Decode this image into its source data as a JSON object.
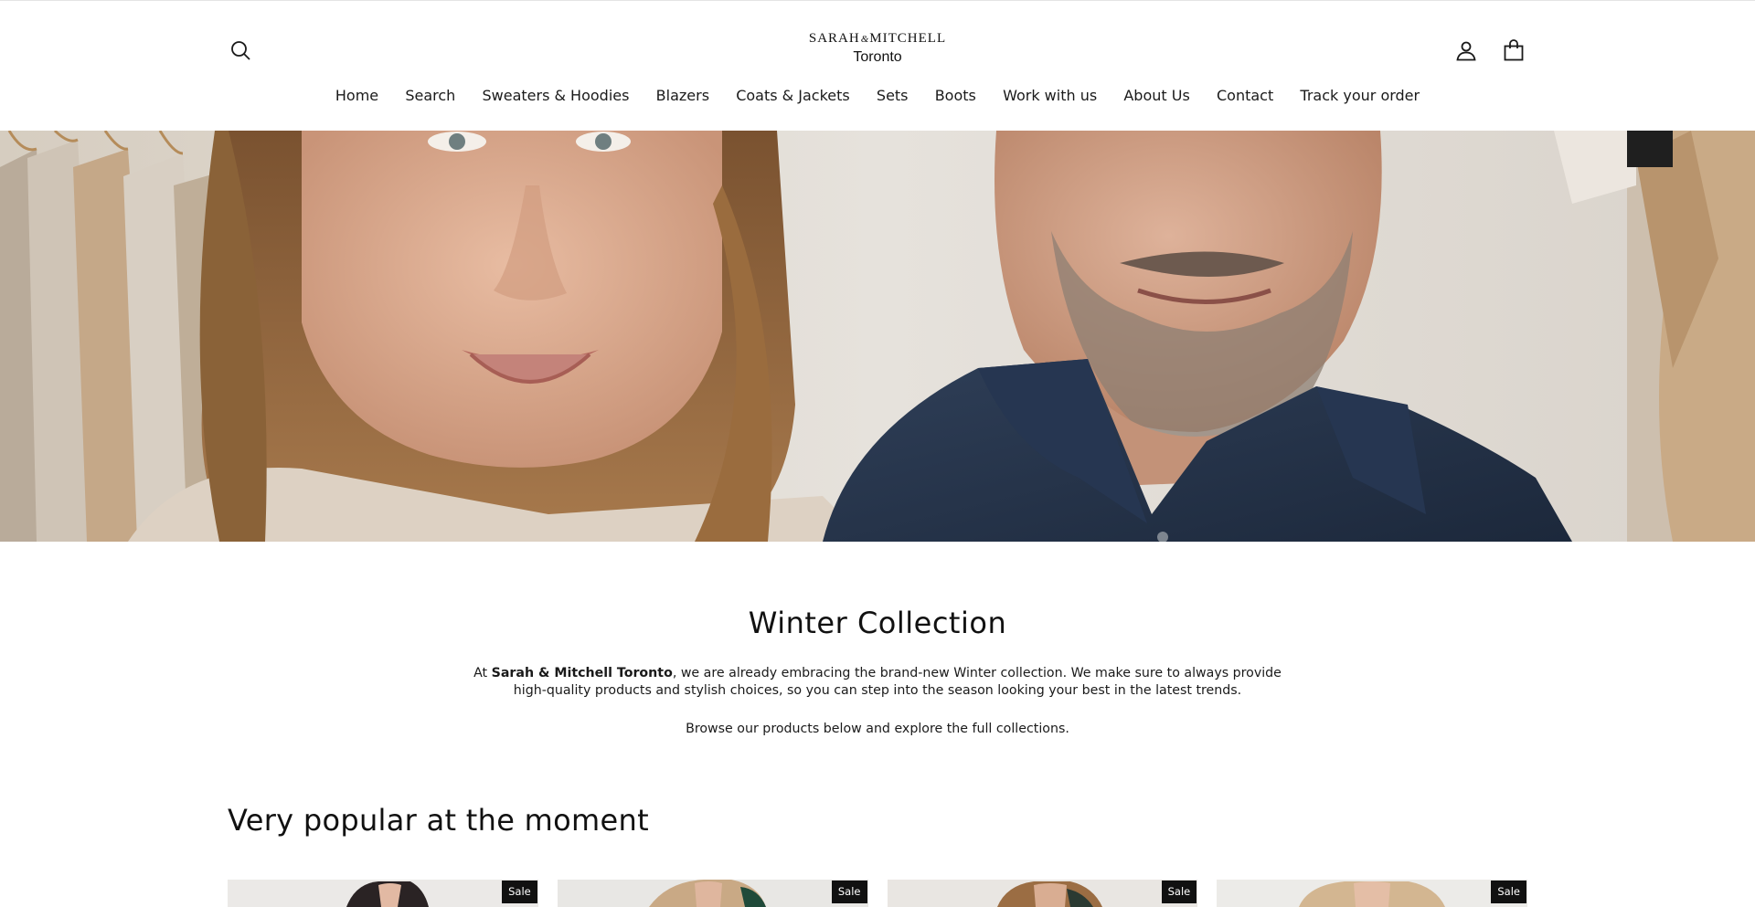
{
  "header": {
    "logo": {
      "brand_left": "SARAH",
      "brand_amp": "&",
      "brand_right": "MITCHELL",
      "city": "Toronto"
    },
    "icons": {
      "search": "search-icon",
      "account": "account-icon",
      "cart": "cart-icon"
    }
  },
  "nav": {
    "items": [
      {
        "label": "Home"
      },
      {
        "label": "Search"
      },
      {
        "label": "Sweaters & Hoodies"
      },
      {
        "label": "Blazers"
      },
      {
        "label": "Coats & Jackets"
      },
      {
        "label": "Sets"
      },
      {
        "label": "Boots"
      },
      {
        "label": "Work with us"
      },
      {
        "label": "About Us"
      },
      {
        "label": "Contact"
      },
      {
        "label": "Track your order"
      }
    ]
  },
  "intro": {
    "title": "Winter Collection",
    "text_before": "At ",
    "text_bold": "Sarah & Mitchell Toronto",
    "text_after": ", we are already embracing the brand-new Winter collection. We make sure to always provide high-quality products and stylish choices, so you can step into the season looking your best in the latest trends.",
    "browse": "Browse our products below and explore the full collections."
  },
  "popular": {
    "title": "Very popular at the moment",
    "products": [
      {
        "badge": "Sale"
      },
      {
        "badge": "Sale"
      },
      {
        "badge": "Sale"
      },
      {
        "badge": "Sale"
      }
    ]
  },
  "colors": {
    "text": "#1a1a1a",
    "badge_bg": "#111111",
    "badge_text": "#ffffff",
    "shirt_navy": "#253349"
  }
}
